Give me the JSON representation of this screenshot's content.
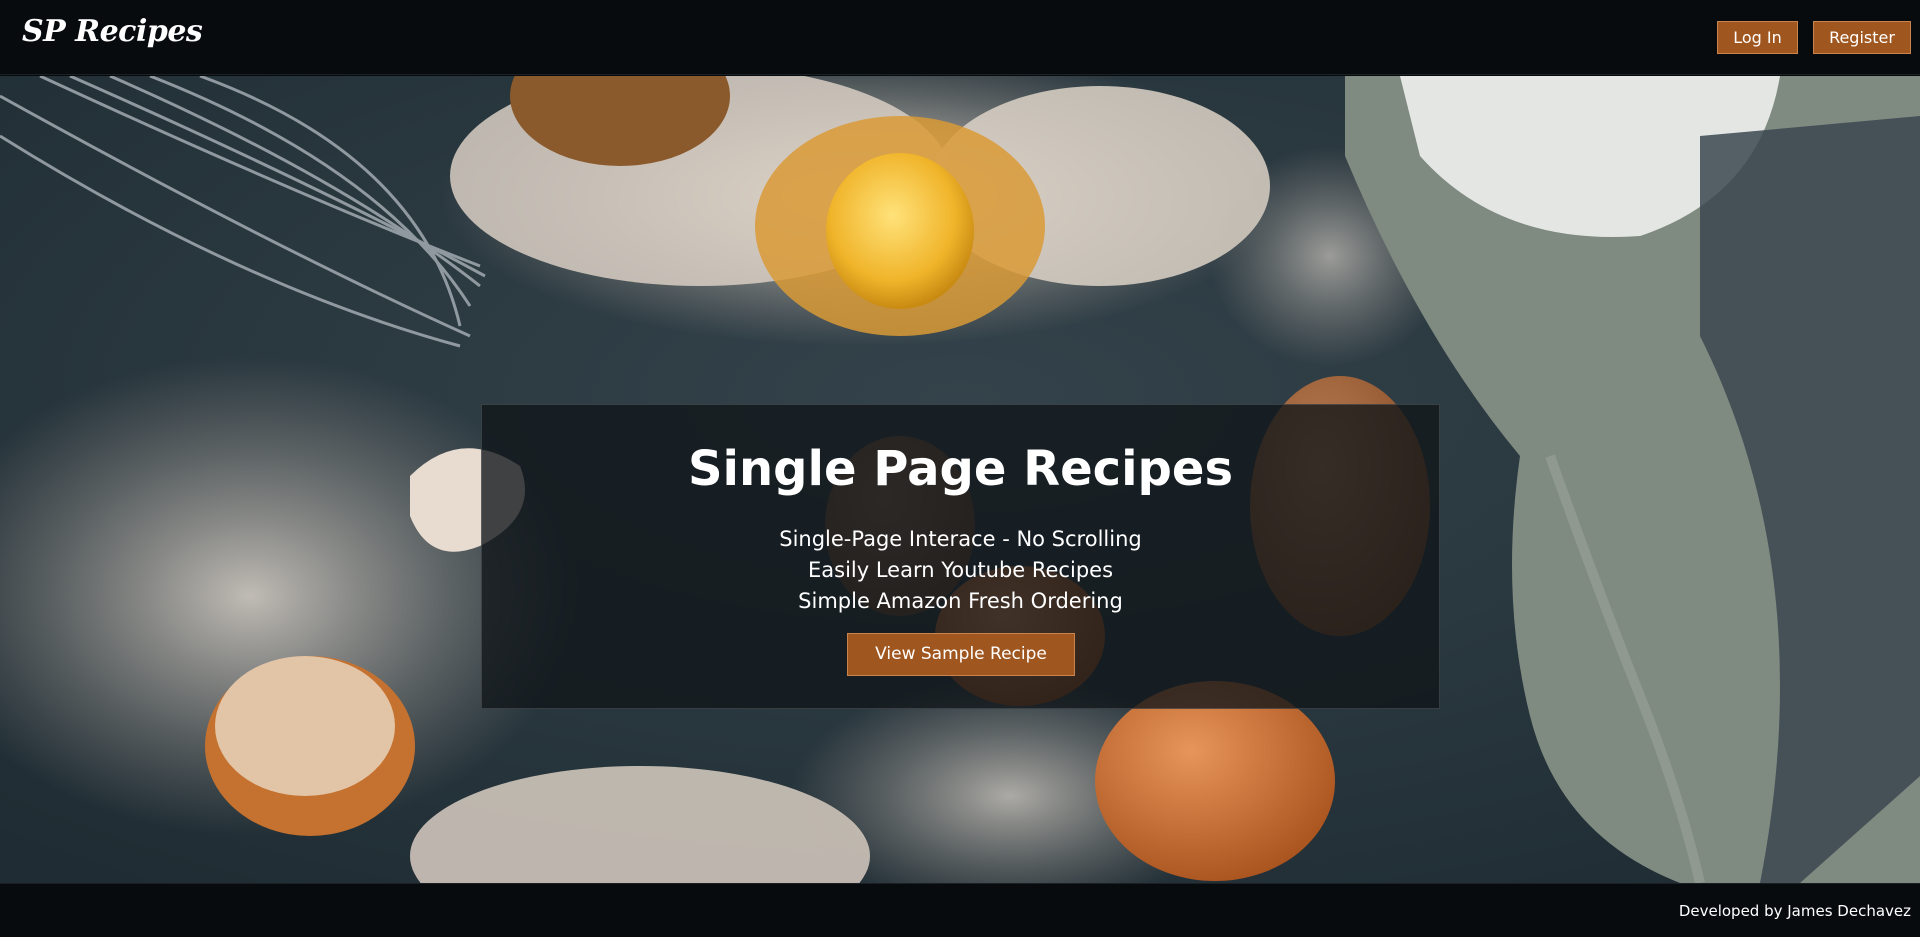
{
  "header": {
    "logo": "SP Recipes",
    "login_label": "Log In",
    "register_label": "Register"
  },
  "hero": {
    "title": "Single Page Recipes",
    "features": [
      "Single-Page Interace - No Scrolling",
      "Easily Learn Youtube Recipes",
      "Simple Amazon Fresh Ordering"
    ],
    "cta_label": "View Sample Recipe"
  },
  "footer": {
    "credit": "Developed by James Dechavez"
  },
  "colors": {
    "accent": "#a0561f",
    "bar_background": "#070b0e",
    "card_overlay": "#111619"
  },
  "icons": [
    "whisk-icon"
  ]
}
